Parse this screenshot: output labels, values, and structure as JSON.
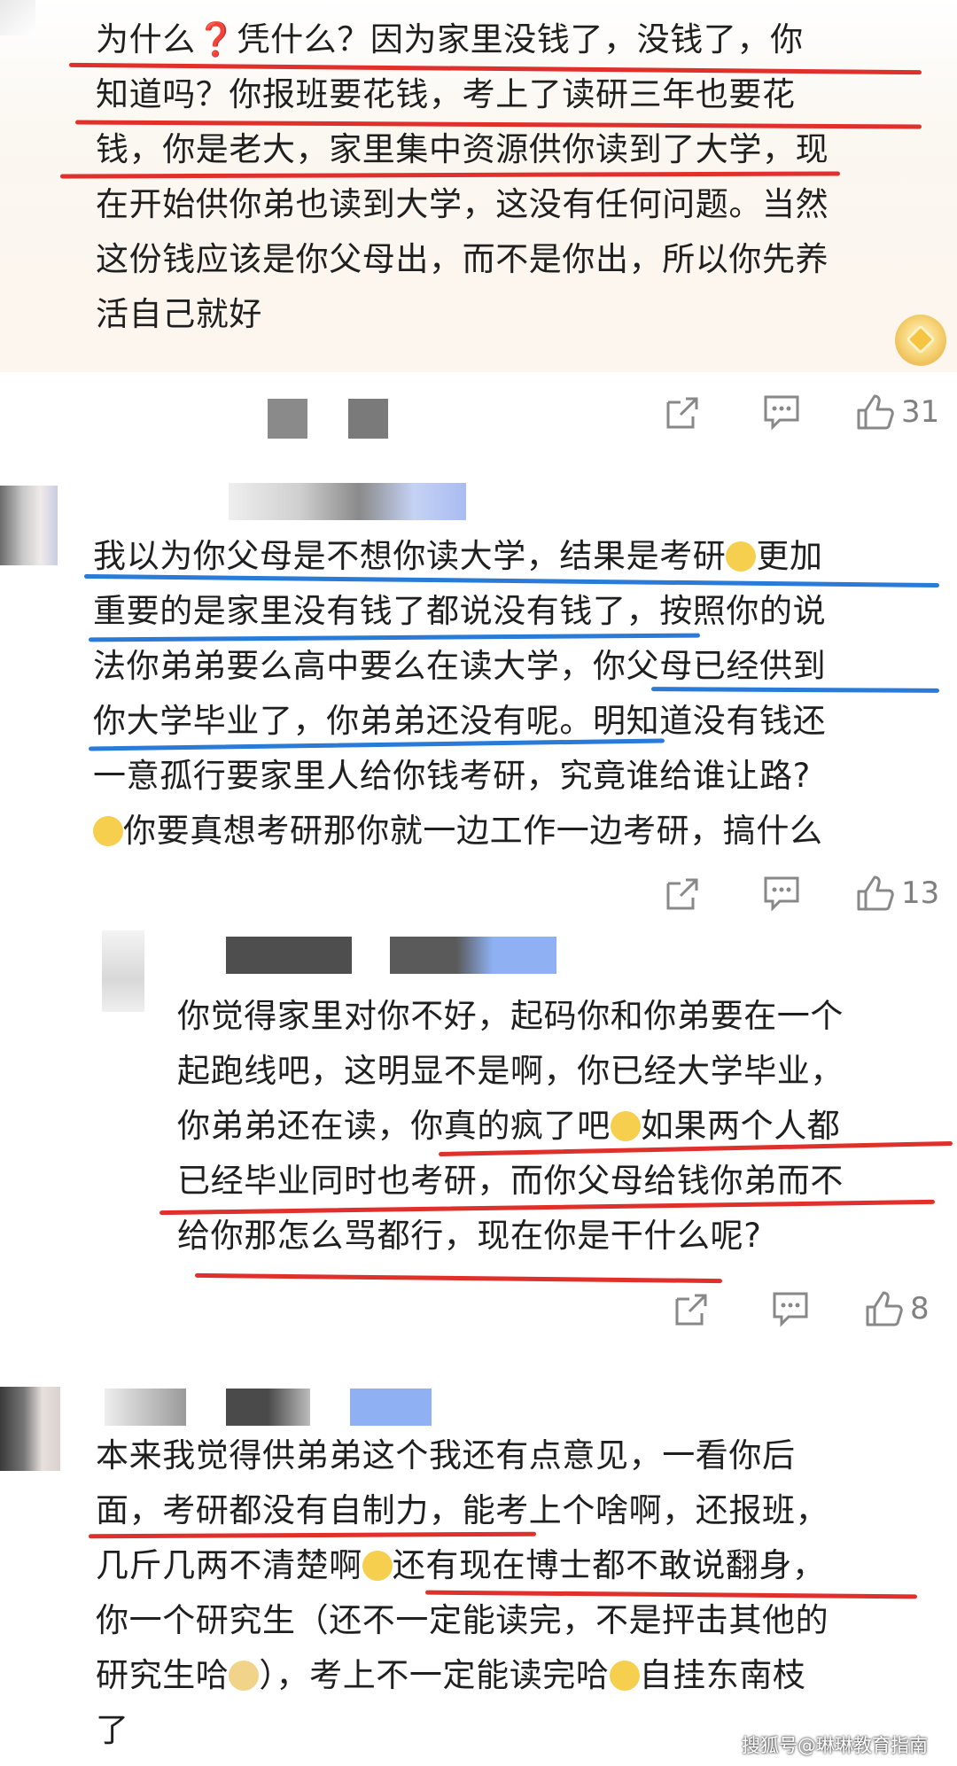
{
  "comments": [
    {
      "lines": [
        "为什么❓凭什么？因为家里没钱了，没钱了，你",
        "知道吗？你报班要花钱，考上了读研三年也要花",
        "钱，你是老大，家里集中资源供你读到了大学，现",
        "在开始供你弟也读到大学，这没有任何问题。当然",
        "这份钱应该是你父母出，而不是你出，所以你先养",
        "活自己就好"
      ],
      "like_count": "31"
    },
    {
      "lines": [
        "我以为你父母是不想你读大学，结果是考研",
        "更加",
        "重要的是家里没有钱了都说没有钱了，按照你的说",
        "法你弟弟要么高中要么在读大学，你父母已经供到",
        "你大学毕业了，你弟弟还没有呢。明知道没有钱还",
        "一意孤行要家里人给你钱考研，究竟谁给谁让路?",
        "你要真想考研那你就一边工作一边考研，搞什么"
      ],
      "like_count": "13"
    },
    {
      "lines": [
        "你觉得家里对你不好，起码你和你弟要在一个",
        "起跑线吧，这明显不是啊，你已经大学毕业，",
        "你弟弟还在读，你真的疯了吧",
        "如果两个人都",
        "已经毕业同时也考研，而你父母给钱你弟而不",
        "给你那怎么骂都行，现在你是干什么呢?"
      ],
      "like_count": "8"
    },
    {
      "lines": [
        "本来我觉得供弟弟这个我还有点意见，一看你后",
        "面，考研都没有自制力，能考上个啥啊，还报班，",
        "几斤几两不清楚啊",
        "还有现在博士都不敢说翻身，",
        "你一个研究生（还不一定能读完，不是抨击其他的",
        "研究生哈",
        "），考上不一定能读完哈",
        "自挂东南枝",
        "了"
      ]
    }
  ],
  "icons": [
    "share-icon",
    "comment-icon",
    "thumbs-up-icon"
  ],
  "colors": {
    "underline_red": "#e0302c",
    "underline_blue": "#2a7ad8"
  },
  "watermark": "搜狐号@琳琳教育指南"
}
